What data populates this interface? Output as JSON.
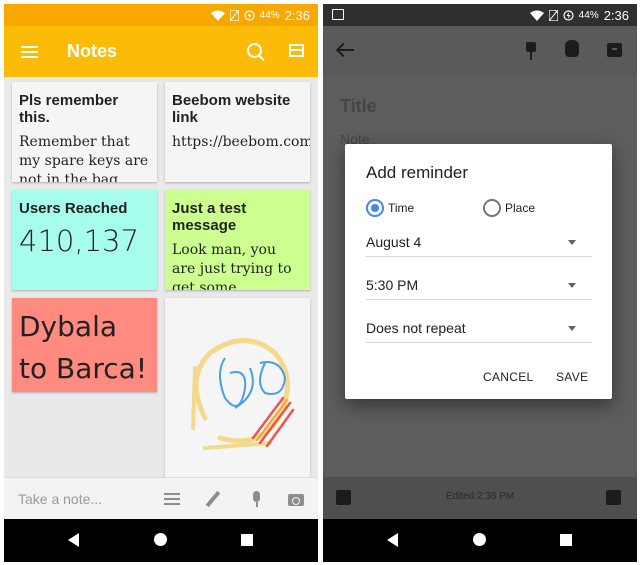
{
  "left_screen": {
    "status": {
      "battery": "44%",
      "time": "2:36"
    },
    "app_bar": {
      "title": "Notes"
    },
    "notes": [
      {
        "title": "Pls remember this.",
        "body": "Remember that my spare keys are not in the bag.",
        "color": "#f5f5f5"
      },
      {
        "title": "Beebom website link",
        "body": "https://beebom.com",
        "color": "#f5f5f5"
      },
      {
        "title": "Users Reached",
        "body": "410,137",
        "color": "#a7fdec"
      },
      {
        "title": "Just a test message",
        "body": "Look man, you are just trying to get some attention.",
        "color": "#ccff90"
      },
      {
        "title": "",
        "body": "Dybala to Barca!",
        "color": "#ff8a80"
      },
      {
        "title": "",
        "body": "",
        "color": "#f5f5f5",
        "content": "drawing"
      }
    ],
    "take_note": {
      "placeholder": "Take a note..."
    }
  },
  "right_screen": {
    "status": {
      "battery": "44%",
      "time": "2:36"
    },
    "editor": {
      "title_placeholder": "Title",
      "note_placeholder": "Note",
      "edited": "Edited 2:36 PM"
    },
    "dialog": {
      "title": "Add reminder",
      "options": [
        {
          "label": "Time",
          "selected": true
        },
        {
          "label": "Place",
          "selected": false
        }
      ],
      "date": "August 4",
      "time": "5:30 PM",
      "repeat": "Does not repeat",
      "cancel": "CANCEL",
      "save": "SAVE"
    }
  },
  "colors": {
    "accent": "#fbbb06",
    "radio": "#4285f4"
  }
}
